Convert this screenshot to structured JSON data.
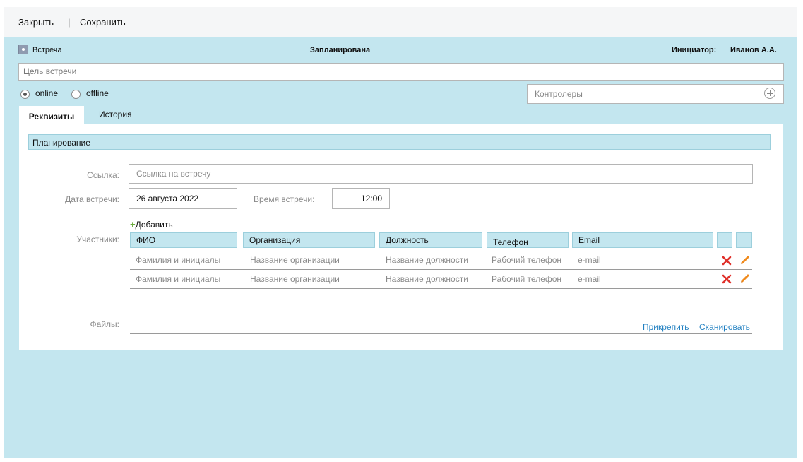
{
  "toolbar": {
    "close_label": "Закрыть",
    "separator": "|",
    "save_label": "Сохранить"
  },
  "header": {
    "meeting_label": "Встреча",
    "status": "Запланирована",
    "initiator_label": "Инициатор:",
    "initiator_name": "Иванов А.А."
  },
  "form": {
    "goal_placeholder": "Цель встречи",
    "format_options": [
      {
        "label": "online",
        "selected": true
      },
      {
        "label": "offline",
        "selected": false
      }
    ],
    "controllers_placeholder": "Контролеры"
  },
  "tabs": [
    {
      "label": "Реквизиты",
      "active": true
    },
    {
      "label": "История",
      "active": false
    }
  ],
  "planning": {
    "section_title": "Планирование",
    "link_label": "Ссылка:",
    "link_placeholder": "Ссылка на встречу",
    "date_label": "Дата встречи:",
    "date_value": "26 августа 2022",
    "time_label": "Время встречи:",
    "time_value": "12:00",
    "participants_label": "Участники:",
    "add_label": "Добавить",
    "columns": [
      "ФИО",
      "Организация",
      "Должность",
      "Телефон",
      "Email"
    ],
    "rows": [
      [
        "Фамилия  и инициалы",
        "Название организации",
        "Название должности",
        "Рабочий телефон",
        "e-mail"
      ],
      [
        "Фамилия  и инициалы",
        "Название организации",
        "Название должности",
        "Рабочий телефон",
        "e-mail"
      ]
    ],
    "files_label": "Файлы:",
    "attach_label": "Прикрепить",
    "scan_label": "Сканировать"
  },
  "colors": {
    "panel_bg": "#c3e6ef",
    "link": "#1f7fc1",
    "delete": "#e0302a",
    "edit": "#f08a1c",
    "add": "#6aaa3a"
  }
}
